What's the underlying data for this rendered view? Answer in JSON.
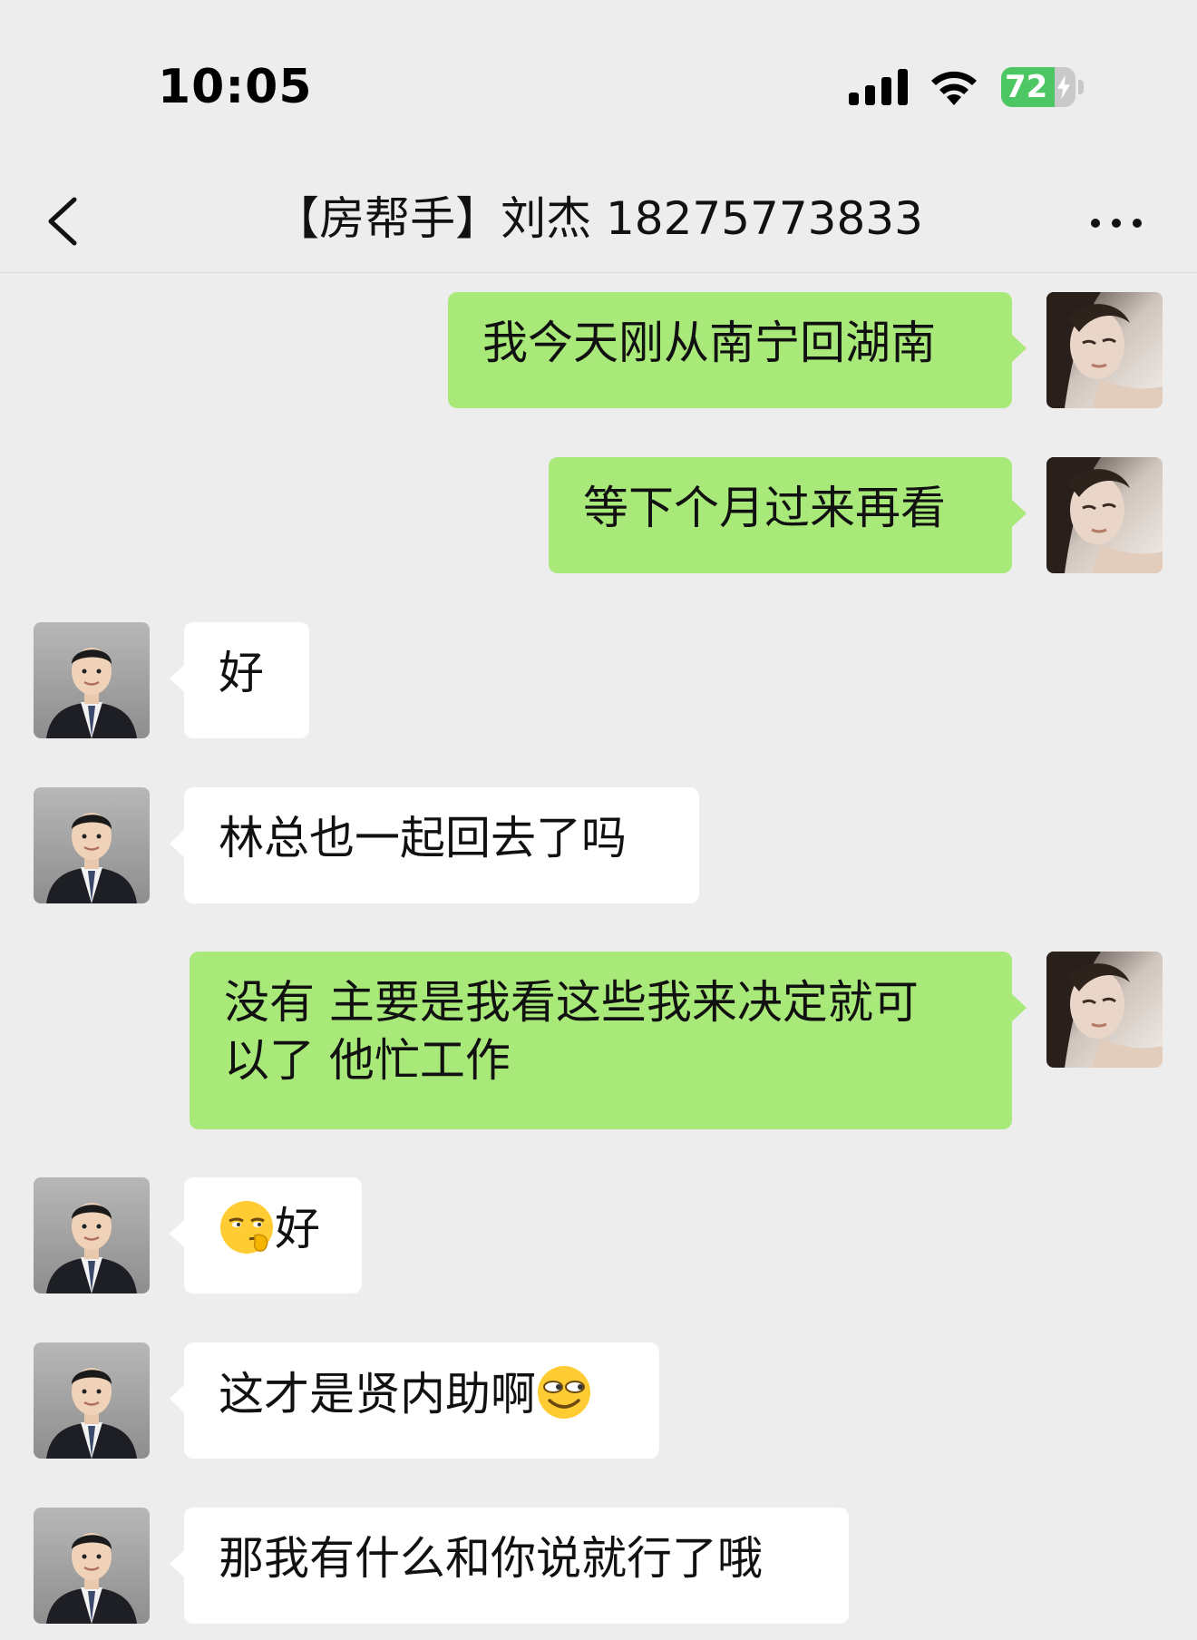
{
  "status_bar": {
    "time": "10:05",
    "battery_level": "72",
    "battery_fraction": 0.72,
    "signal_icon": "cellular-signal-icon",
    "wifi_icon": "wifi-icon",
    "charging_icon": "bolt-icon"
  },
  "nav": {
    "title": "【房帮手】刘杰 18275773833",
    "back_icon": "chevron-left-icon",
    "more_icon": "more-dots-icon"
  },
  "messages": [
    {
      "side": "out",
      "text": "我今天刚从南宁回湖南"
    },
    {
      "side": "out",
      "text": "等下个月过来再看"
    },
    {
      "side": "in",
      "text": "好"
    },
    {
      "side": "in",
      "text": "林总也一起回去了吗"
    },
    {
      "side": "out",
      "text_line1": "没有 主要是我看这些我来决定就可",
      "text_line2": "以了 他忙工作"
    },
    {
      "side": "in",
      "emoji": "smirk-shush-emoji",
      "text": "好"
    },
    {
      "side": "in",
      "text": "这才是贤内助啊",
      "emoji": "sly-smile-emoji"
    },
    {
      "side": "in",
      "text": "那我有什么和你说就行了哦"
    }
  ],
  "colors": {
    "background": "#ededed",
    "outgoing_bubble": "#a9e97a",
    "incoming_bubble": "#ffffff",
    "battery_green": "#4cc764"
  }
}
